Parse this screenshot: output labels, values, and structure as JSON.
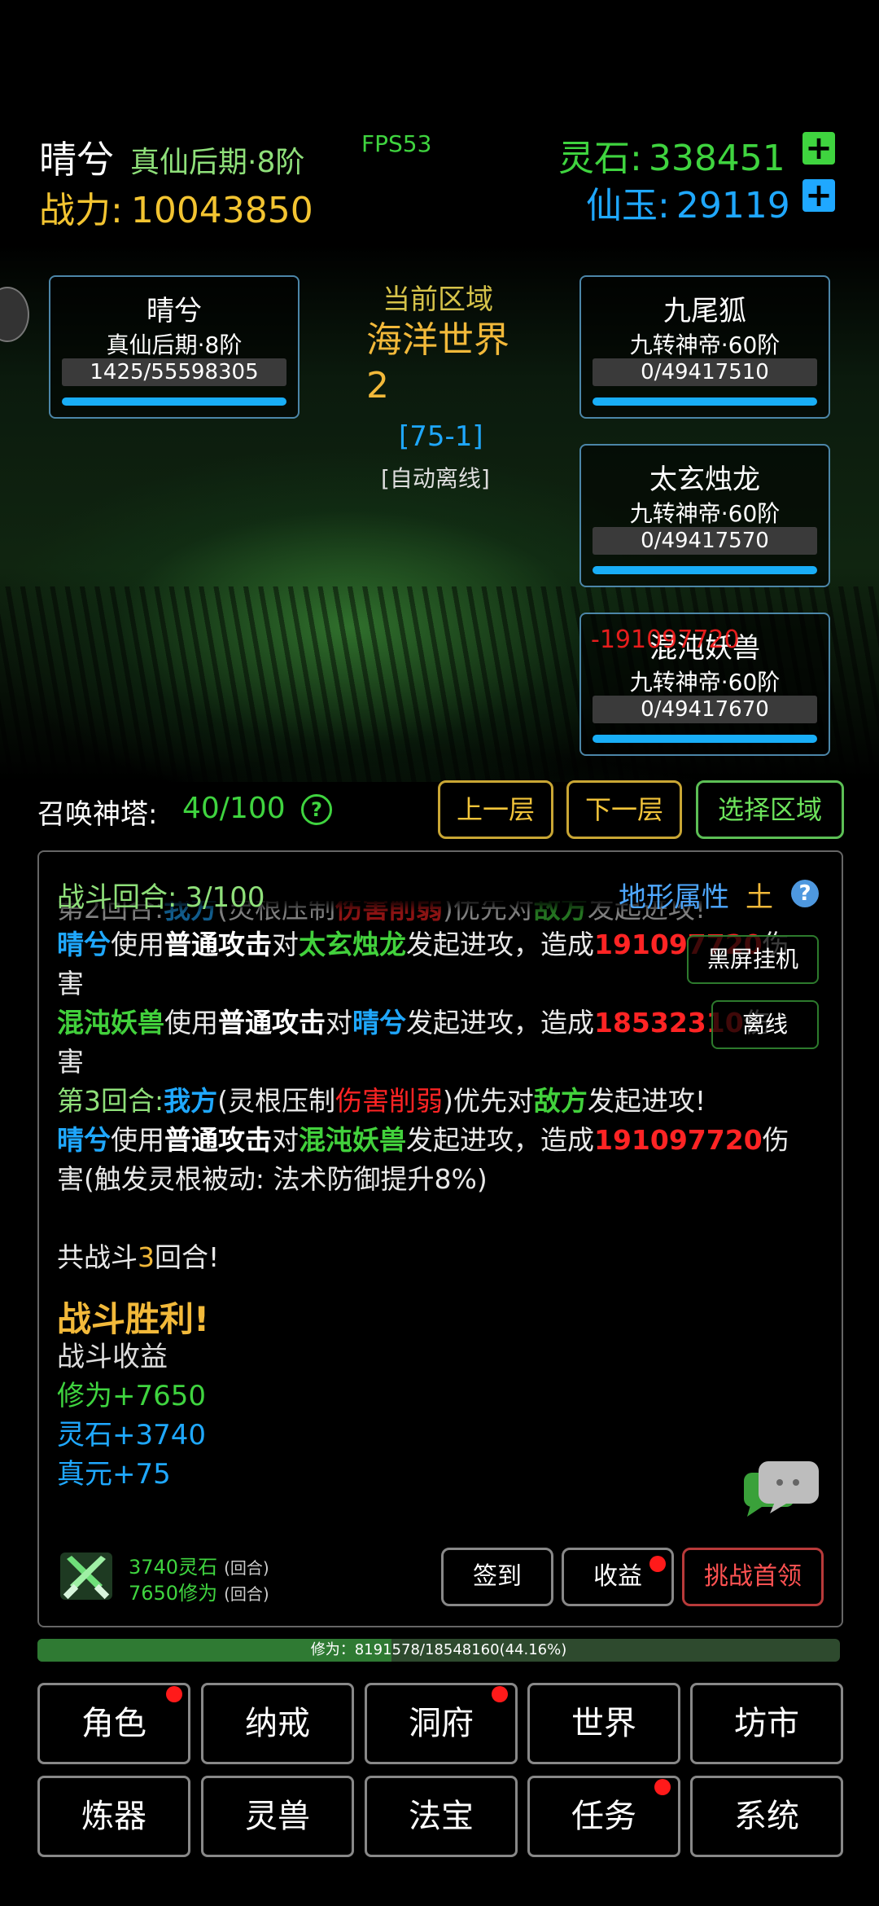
{
  "header": {
    "player_name": "晴兮",
    "realm": "真仙后期·8阶",
    "fps": "FPS53",
    "power_label": "战力:",
    "power_value": "10043850",
    "stone_label": "灵石:",
    "stone_value": "338451",
    "jade_label": "仙玉:",
    "jade_value": "29119",
    "plus_symbol": "+"
  },
  "region": {
    "label": "当前区域",
    "name": "海洋世界2",
    "code": "[75-1]",
    "mode": "[自动离线]"
  },
  "player_card": {
    "name": "晴兮",
    "realm": "真仙后期·8阶",
    "hp": "1425/55598305"
  },
  "enemies": [
    {
      "name": "九尾狐",
      "realm": "九转神帝·60阶",
      "hp": "0/49417510"
    },
    {
      "name": "太玄烛龙",
      "realm": "九转神帝·60阶",
      "hp": "0/49417570"
    },
    {
      "name": "混沌妖兽",
      "realm": "九转神帝·60阶",
      "hp": "0/49417670"
    }
  ],
  "floating_damage": "-191097720",
  "tower": {
    "label": "召唤神塔:",
    "value": "40/100",
    "help": "?",
    "prev_button": "上一层",
    "next_button": "下一层",
    "select_button": "选择区域"
  },
  "battle": {
    "round_label": "战斗回合:",
    "round_value": "3/100",
    "terrain_label": "地形属性",
    "terrain_value": "土",
    "help": "?",
    "side_buttons": {
      "blackscreen": "黑屏挂机",
      "offline": "离线"
    },
    "log": {
      "l0a": "第2回合:",
      "l0b": "我方",
      "l0c": "(灵根压制",
      "l0d": "伤害削弱",
      "l0e": ")优先对",
      "l0f": "敌方",
      "l0g": "发起进攻!",
      "l1a": "晴兮",
      "l1b": "使用",
      "l1c": "普通攻击",
      "l1d": "对",
      "l1e": "太玄烛龙",
      "l1f": "发起进攻，造成",
      "l1g": "191097720",
      "l1h": "伤",
      "l2a": "害",
      "l3a": "混沌妖兽",
      "l3b": "使用",
      "l3c": "普通攻击",
      "l3d": "对",
      "l3e": "晴兮",
      "l3f": "发起进攻，造成",
      "l3g": "18532310",
      "l3h": "伤",
      "l4a": "害",
      "l5a": "第3回合:",
      "l5b": "我方",
      "l5c": "(灵根压制",
      "l5d": "伤害削弱",
      "l5e": ")优先对",
      "l5f": "敌方",
      "l5g": "发起进攻!",
      "l6a": "晴兮",
      "l6b": "使用",
      "l6c": "普通攻击",
      "l6d": "对",
      "l6e": "混沌妖兽",
      "l6f": "发起进攻，造成",
      "l6g": "191097720",
      "l6h": "伤",
      "l7a": "害(触发灵根被动: 法术防御提升8%)",
      "l8a": "共战斗",
      "l8b": "3",
      "l8c": "回合!"
    },
    "victory": "战斗胜利!",
    "rewards_title": "战斗收益",
    "reward_xiuwei": "修为+7650",
    "reward_stone": "灵石+3740",
    "reward_zhenyuan": "真元+75"
  },
  "income": {
    "stone": "3740灵石",
    "xiuwei": "7650修为",
    "per_round": "(回合)",
    "checkin_button": "签到",
    "income_button": "收益",
    "challenge_button": "挑战首领"
  },
  "xp_bar": {
    "text": "修为：8191578/18548160(44.16%)",
    "progress": 0.4416
  },
  "nav": {
    "row1": [
      "角色",
      "纳戒",
      "洞府",
      "世界",
      "坊市"
    ],
    "row2": [
      "炼器",
      "灵兽",
      "法宝",
      "任务",
      "系统"
    ]
  },
  "colors": {
    "green": "#3fd43f",
    "blue": "#1fa8ff",
    "gold": "#f2b93a",
    "red": "#ff2424",
    "hp_bar": "#19aef7"
  },
  "icons": [
    "plus-icon",
    "help-icon",
    "chat-bubble-icon",
    "crossed-swords-icon",
    "notification-dot-icon"
  ]
}
